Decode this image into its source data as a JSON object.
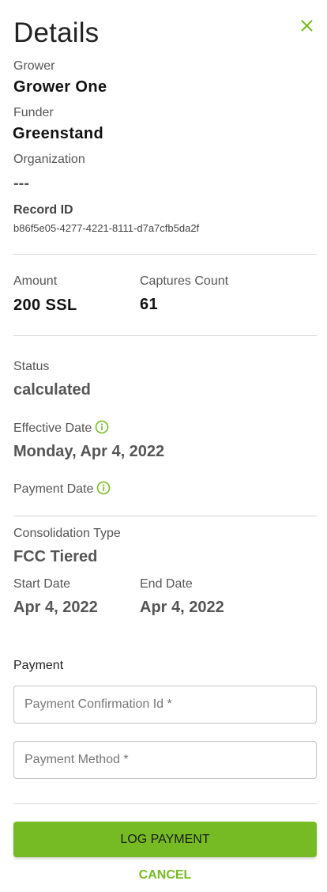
{
  "header": {
    "title": "Details",
    "close_icon": "close-icon"
  },
  "grower": {
    "label": "Grower",
    "value": "Grower One"
  },
  "funder": {
    "label": "Funder",
    "value": "Greenstand"
  },
  "organization": {
    "label": "Organization",
    "value": "---"
  },
  "record": {
    "label": "Record ID",
    "value": "b86f5e05-4277-4221-8111-d7a7cfb5da2f"
  },
  "amount": {
    "label": "Amount",
    "value": "200 SSL"
  },
  "captures": {
    "label": "Captures Count",
    "value": "61"
  },
  "status": {
    "label": "Status",
    "value": "calculated"
  },
  "effective_date": {
    "label": "Effective Date",
    "value": "Monday, Apr 4, 2022",
    "icon": "info-icon"
  },
  "payment_date": {
    "label": "Payment Date",
    "icon": "info-icon"
  },
  "consolidation": {
    "label": "Consolidation Type",
    "value": "FCC Tiered"
  },
  "start_date": {
    "label": "Start Date",
    "value": "Apr 4, 2022"
  },
  "end_date": {
    "label": "End Date",
    "value": "Apr 4, 2022"
  },
  "payment": {
    "section_label": "Payment",
    "confirmation_placeholder": "Payment Confirmation Id *",
    "confirmation_value": "",
    "method_placeholder": "Payment Method *",
    "method_value": ""
  },
  "actions": {
    "log_payment": "LOG PAYMENT",
    "cancel": "CANCEL"
  },
  "colors": {
    "accent": "#76bb23",
    "divider": "#d8d8d8"
  }
}
